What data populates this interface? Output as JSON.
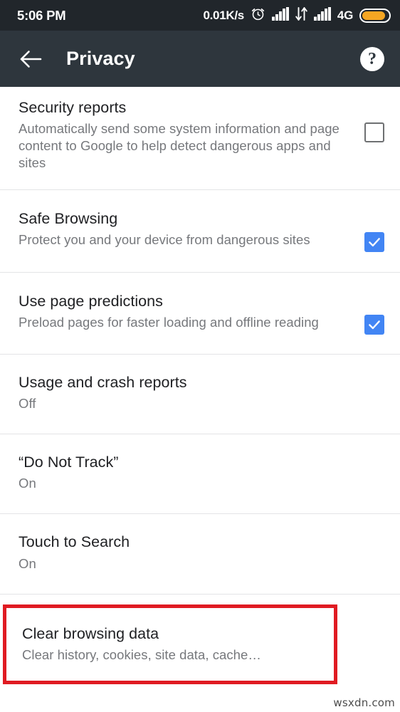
{
  "status_bar": {
    "clock": "5:06 PM",
    "network_speed": "0.01K/s",
    "network_type": "4G",
    "icons": [
      "alarm-clock-icon",
      "signal-bars-icon",
      "data-transfer-icon",
      "signal-bars-icon",
      "battery-icon"
    ],
    "battery_level_percent": 88,
    "background_color": "#21262b"
  },
  "app_bar": {
    "back_label": "←",
    "title": "Privacy",
    "help_label": "?",
    "background_color": "#2e363d"
  },
  "settings": [
    {
      "title": "Security reports",
      "summary": "Automatically send some system information and page content to Google to help detect dangerous apps and sites",
      "control": "checkbox",
      "checked": false
    },
    {
      "title": "Safe Browsing",
      "summary": "Protect you and your device from dangerous sites",
      "control": "checkbox",
      "checked": true
    },
    {
      "title": "Use page predictions",
      "summary": "Preload pages for faster loading and offline reading",
      "control": "checkbox",
      "checked": true
    },
    {
      "title": "Usage and crash reports",
      "summary": "Off",
      "control": "none",
      "checked": null
    },
    {
      "title": "“Do Not Track”",
      "summary": "On",
      "control": "none",
      "checked": null
    },
    {
      "title": "Touch to Search",
      "summary": "On",
      "control": "none",
      "checked": null
    }
  ],
  "highlighted_item": {
    "title": "Clear browsing data",
    "summary": "Clear history, cookies, site data, cache…",
    "highlight_color": "#e01b22"
  },
  "watermark": "wsxdn.com",
  "colors": {
    "checkbox_checked": "#4285f4",
    "checkbox_unchecked_border": "#6e7072",
    "title_text": "#202124",
    "summary_text": "#76787c",
    "divider": "#e3e4e6",
    "battery_fill": "#f5a623"
  }
}
